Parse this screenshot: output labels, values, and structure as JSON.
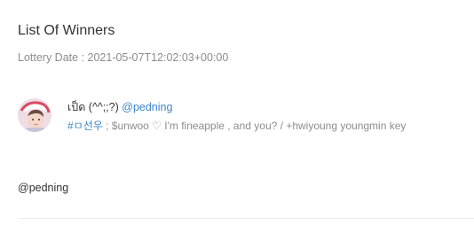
{
  "header": {
    "title": "List Of Winners",
    "lottery_date": "Lottery Date : 2021-05-07T12:02:03+00:00"
  },
  "winner": {
    "display_name": "เป็ด (^^;;?)",
    "handle_link": "@pedning",
    "bio_hashtag": "#ㅁ선우",
    "bio_text": "; $unwoo ♡ I'm fineapple , and you? / +hwiyoung youngmin key",
    "handle": "@pedning"
  },
  "colors": {
    "link": "#3a86c8",
    "muted": "#8c8c8c",
    "text": "#333333"
  }
}
